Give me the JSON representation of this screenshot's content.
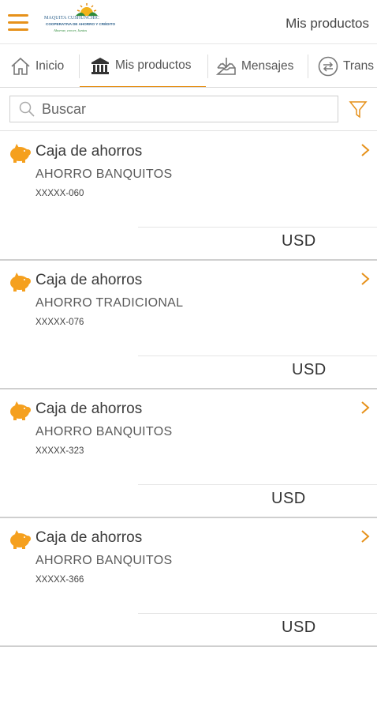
{
  "header": {
    "title": "Mis productos",
    "logo": {
      "name": "MAQUITA CUSHUNCHIC",
      "subtitle": "COOPERATIVA DE AHORRO Y CRÉDITO",
      "slogan": "Ahorrar, crecer, Juntos"
    }
  },
  "tabs": [
    {
      "label": "Inicio",
      "icon": "home-icon"
    },
    {
      "label": "Mis productos",
      "icon": "bank-icon"
    },
    {
      "label": "Mensajes",
      "icon": "inbox-icon"
    },
    {
      "label": "Trans",
      "icon": "transfer-icon"
    }
  ],
  "search": {
    "placeholder": "Buscar",
    "value": ""
  },
  "accounts": [
    {
      "type": "Caja de ahorros",
      "product": "AHORRO BANQUITOS",
      "number": "XXXXX-060",
      "currency": "USD"
    },
    {
      "type": "Caja de ahorros",
      "product": "AHORRO TRADICIONAL",
      "number": "XXXXX-076",
      "currency": "USD"
    },
    {
      "type": "Caja de ahorros",
      "product": "AHORRO BANQUITOS",
      "number": "XXXXX-323",
      "currency": "USD"
    },
    {
      "type": "Caja de ahorros",
      "product": "AHORRO BANQUITOS",
      "number": "XXXXX-366",
      "currency": "USD"
    }
  ],
  "colors": {
    "accent": "#e6911a",
    "divider": "#cfcfcf",
    "text": "#3b3b3b"
  }
}
